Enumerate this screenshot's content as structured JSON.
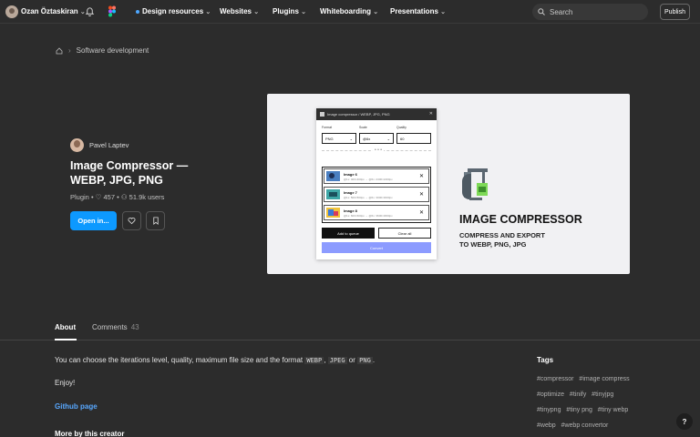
{
  "topbar": {
    "username": "Ozan Öztaskiran",
    "nav": [
      "Design resources",
      "Websites",
      "Plugins",
      "Whiteboarding",
      "Presentations"
    ],
    "search_placeholder": "Search",
    "publish_label": "Publish"
  },
  "breadcrumb": {
    "category": "Software development"
  },
  "plugin": {
    "author": "Pavel Laptev",
    "title": "Image Compressor — WEBP, JPG, PNG",
    "type": "Plugin",
    "likes": "457",
    "users": "51.9k users",
    "open_label": "Open in..."
  },
  "preview": {
    "window_title": "Image compressor  /  WEBP, JPG, PNG",
    "format_label": "Format",
    "format_value": "PNG",
    "scale_label": "Scale",
    "scale_value": "@6x",
    "quality_label": "Quality",
    "quality_value": "60",
    "files": [
      {
        "name": "Image 6",
        "detail": "@1x: 400×400px → @6x: 2400×2400px"
      },
      {
        "name": "Image 7",
        "detail": "@1x: 500×500px → @6x: 3000×3000px"
      },
      {
        "name": "Image 8",
        "detail": "@1x: 600×600px → @6x: 3600×3600px"
      }
    ],
    "add_label": "Add to queue",
    "clear_label": "Clear all",
    "convert_label": "Convert",
    "promo_title": "IMAGE COMPRESSOR",
    "promo_line1": "COMPRESS AND EXPORT",
    "promo_line2": "TO WEBP, PNG, JPG"
  },
  "tabs": {
    "about": "About",
    "comments": "Comments",
    "comments_count": "43"
  },
  "about": {
    "desc_before": "You can choose the iterations level, quality, maximum file size and the format",
    "fmt1": "WEBP",
    "sep1": ",",
    "fmt2": "JPEG",
    "or": "or",
    "fmt3": "PNG",
    "end": ".",
    "enjoy": "Enjoy!",
    "github": "Github page",
    "more": "More by this creator"
  },
  "tags": {
    "title": "Tags",
    "rows": [
      [
        "#compressor",
        "#image compress"
      ],
      [
        "#optimize",
        "#tinify",
        "#tinyjpg"
      ],
      [
        "#tinypng",
        "#tiny png",
        "#tiny webp"
      ],
      [
        "#webp",
        "#webp convertor"
      ]
    ]
  },
  "help": "?",
  "colors": {
    "accent": "#0d99ff",
    "convert": "#8c9bff",
    "link": "#58a8ff"
  }
}
